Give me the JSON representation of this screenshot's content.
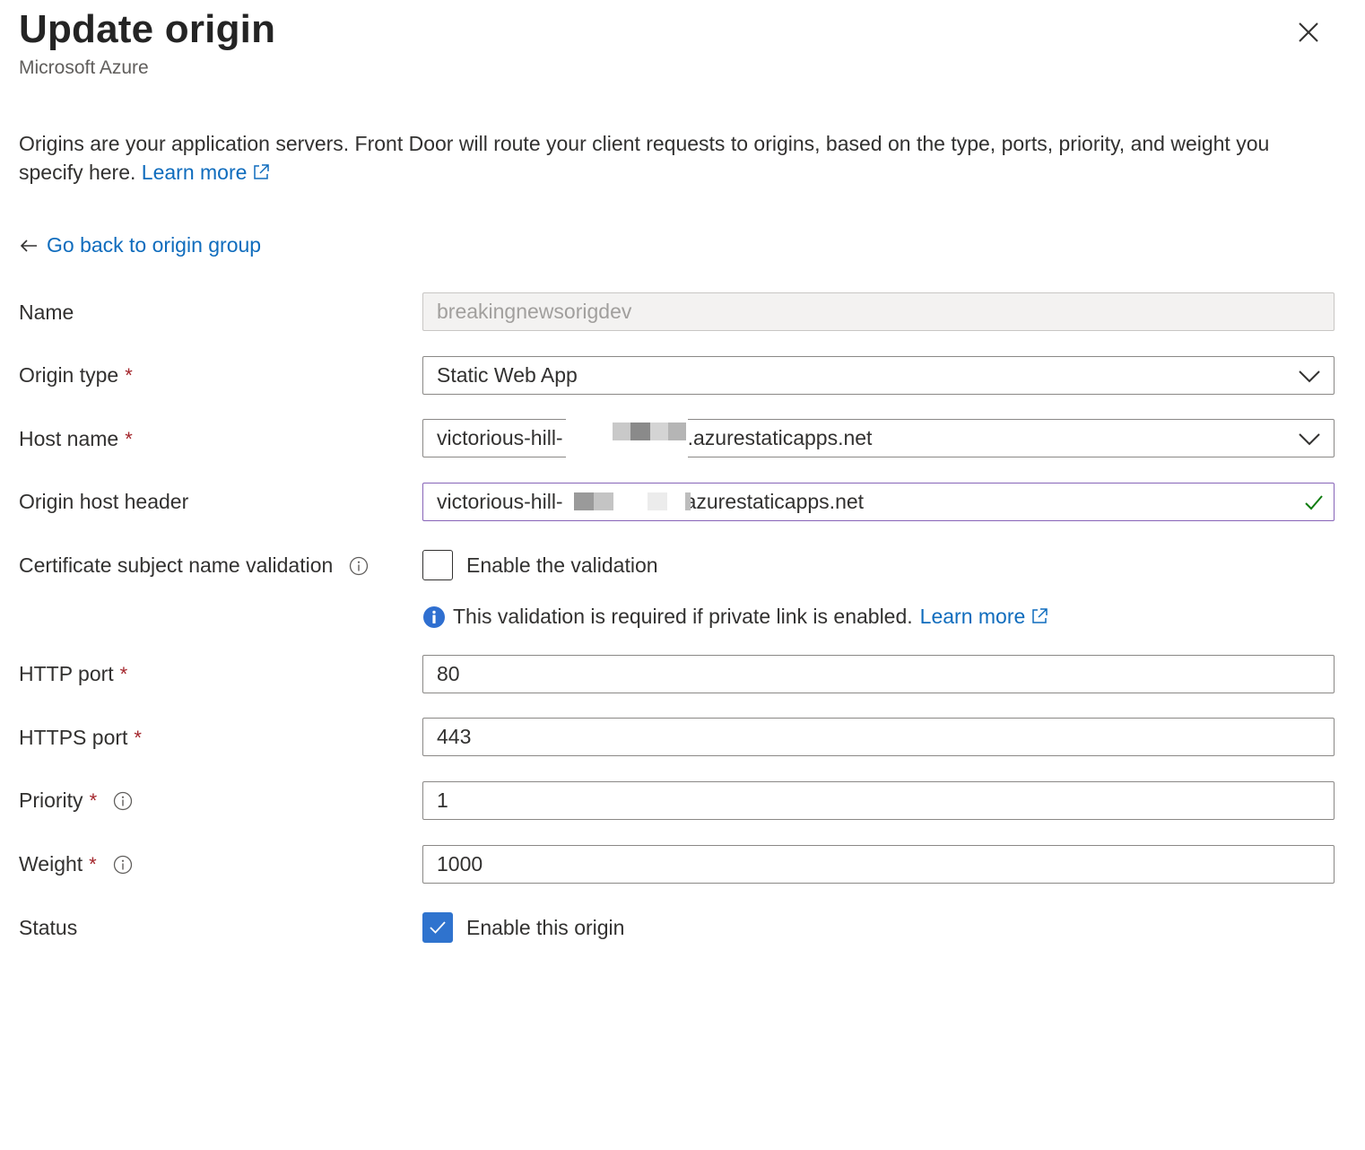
{
  "header": {
    "title": "Update origin",
    "subtitle": "Microsoft Azure"
  },
  "description": {
    "text": "Origins are your application servers. Front Door will route your client requests to origins, based on the type, ports, priority, and weight you specify here.",
    "learn_more": "Learn more"
  },
  "back_link": "Go back to origin group",
  "form": {
    "name": {
      "label": "Name",
      "value": "breakingnewsorigdev"
    },
    "origin_type": {
      "label": "Origin type",
      "required": "*",
      "value": "Static Web App"
    },
    "host_name": {
      "label": "Host name",
      "required": "*",
      "value_prefix": "victorious-hill-",
      "value_suffix": ".azurestaticapps.net"
    },
    "origin_host_header": {
      "label": "Origin host header",
      "value_prefix": "victorious-hill-",
      "value_suffix": "azurestaticapps.net"
    },
    "cert_validation": {
      "label": "Certificate subject name validation",
      "checkbox_label": "Enable the validation",
      "checked": false,
      "note": "This validation is required if private link is enabled.",
      "note_link": "Learn more"
    },
    "http_port": {
      "label": "HTTP port",
      "required": "*",
      "value": "80"
    },
    "https_port": {
      "label": "HTTPS port",
      "required": "*",
      "value": "443"
    },
    "priority": {
      "label": "Priority",
      "required": "*",
      "value": "1"
    },
    "weight": {
      "label": "Weight",
      "required": "*",
      "value": "1000"
    },
    "status": {
      "label": "Status",
      "checkbox_label": "Enable this origin",
      "checked": true
    }
  },
  "colors": {
    "link": "#0f6cbd",
    "required": "#a4262c",
    "checkbox_checked": "#2f73ce",
    "valid_check": "#107c10",
    "focus_border": "#8764b8"
  },
  "icons": [
    "close-icon",
    "external-link-icon",
    "arrow-left-icon",
    "chevron-down-icon",
    "checkmark-icon",
    "info-icon"
  ]
}
